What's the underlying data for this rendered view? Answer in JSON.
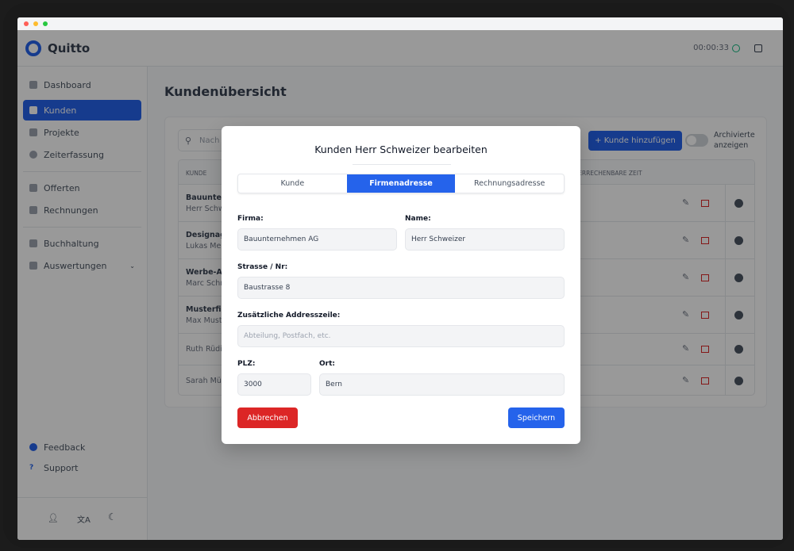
{
  "app": {
    "name": "Quitto",
    "timer": "00:00:33"
  },
  "sidebar": {
    "items": [
      {
        "label": "Dashboard"
      },
      {
        "label": "Kunden",
        "active": true
      },
      {
        "label": "Projekte"
      },
      {
        "label": "Zeiterfassung"
      },
      {
        "label": "Offerten"
      },
      {
        "label": "Rechnungen"
      },
      {
        "label": "Buchhaltung"
      },
      {
        "label": "Auswertungen"
      }
    ],
    "bottom": [
      {
        "label": "Feedback"
      },
      {
        "label": "Support"
      }
    ]
  },
  "main": {
    "title": "Kundenübersicht",
    "search_placeholder": "Nach Kunden suchen",
    "add_button": "+ Kunde hinzufügen",
    "archive_toggle": "Archivierte anzeigen",
    "columns": [
      "KUNDE",
      "VERRECHENBARE ZEIT"
    ],
    "rows": [
      {
        "company": "Bauunternehmen AG",
        "person": "Herr Schweizer"
      },
      {
        "company": "Designagentur",
        "person": "Lukas Meier"
      },
      {
        "company": "Werbe-Agentur",
        "person": "Marc Schneider"
      },
      {
        "company": "Musterfirma",
        "person": "Max Mustermann"
      },
      {
        "company": "",
        "person": "Ruth Rüdisühli"
      },
      {
        "company": "",
        "person": "Sarah Müller"
      }
    ]
  },
  "modal": {
    "title": "Kunden Herr Schweizer bearbeiten",
    "tabs": [
      "Kunde",
      "Firmenadresse",
      "Rechnungsadresse"
    ],
    "active_tab": "Firmenadresse",
    "fields": {
      "firma_label": "Firma:",
      "firma": "Bauunternehmen AG",
      "name_label": "Name:",
      "name": "Herr Schweizer",
      "strasse_label": "Strasse / Nr:",
      "strasse": "Baustrasse 8",
      "zusatz_label": "Zusätzliche Addresszeile:",
      "zusatz_placeholder": "Abteilung, Postfach, etc.",
      "plz_label": "PLZ:",
      "plz": "3000",
      "ort_label": "Ort:",
      "ort": "Bern"
    },
    "cancel": "Abbrechen",
    "save": "Speichern"
  },
  "colors": {
    "primary": "#2563eb",
    "danger": "#dc2626"
  }
}
